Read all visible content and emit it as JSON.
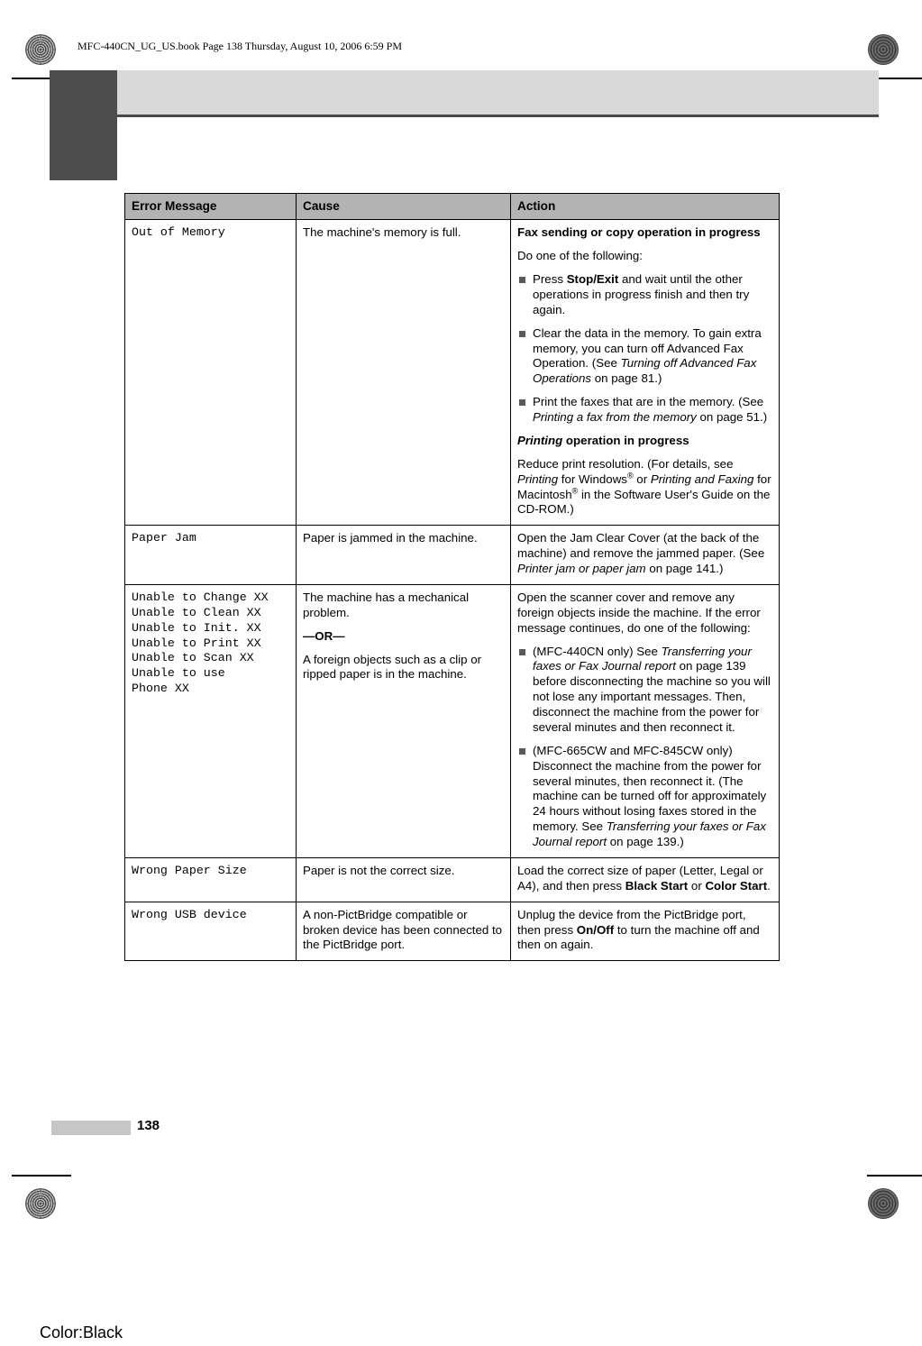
{
  "page": {
    "header_line": "MFC-440CN_UG_US.book  Page 138  Thursday, August 10, 2006  6:59 PM",
    "page_number": "138",
    "color_note": "Color:Black"
  },
  "table": {
    "headers": [
      "Error Message",
      "Cause",
      "Action"
    ],
    "rows": [
      {
        "error_message": "Out of Memory",
        "cause": "The machine's memory is full.",
        "action_blocks": [
          {
            "kind": "heading",
            "text": "Fax sending or copy operation in progress"
          },
          {
            "kind": "para",
            "text": "Do one of the following:"
          },
          {
            "kind": "bullets",
            "items": [
              "Press Stop/Exit and wait until the other operations in progress finish and then try again.",
              "Clear the data in the memory. To gain extra memory, you can turn off Advanced Fax Operation. (See Turning off Advanced Fax Operations on page 81.)",
              "Print the faxes that are in the memory. (See Printing a fax from the memory on page 51.)"
            ]
          },
          {
            "kind": "heading",
            "text": "Printing operation in progress"
          },
          {
            "kind": "para",
            "text": "Reduce print resolution. (For details, see Printing for Windows® or Printing and Faxing for Macintosh® in the Software User's Guide on the CD-ROM.)"
          }
        ]
      },
      {
        "error_message": "Paper Jam",
        "cause": "Paper is jammed in the machine.",
        "action_blocks": [
          {
            "kind": "para",
            "text": "Open the Jam Clear Cover (at the back of the machine) and remove the jammed paper. (See Printer jam or paper jam on page 141.)"
          }
        ]
      },
      {
        "error_message": "Unable to Change XX\nUnable to Clean XX\nUnable to Init. XX\nUnable to Print XX\nUnable to Scan XX\nUnable to use\nPhone XX",
        "cause_blocks": [
          {
            "kind": "para",
            "text": "The machine has a mechanical problem."
          },
          {
            "kind": "or",
            "text": "—OR—"
          },
          {
            "kind": "para",
            "text": "A foreign objects such as a clip or ripped paper is in the machine."
          }
        ],
        "action_blocks": [
          {
            "kind": "para",
            "text": "Open the scanner cover and remove any foreign objects inside the machine. If the error message continues, do one of the following:"
          },
          {
            "kind": "bullets",
            "items": [
              "(MFC-440CN only) See Transferring your faxes or Fax Journal report on page 139 before disconnecting the machine so you will not lose any important messages. Then, disconnect the machine from the power for several minutes and then reconnect it.",
              "(MFC-665CW and MFC-845CW only) Disconnect the machine from the power for several minutes, then reconnect it. (The machine can be turned off for approximately 24 hours without losing faxes stored in the memory. See Transferring your faxes or Fax Journal report on page 139.)"
            ]
          }
        ]
      },
      {
        "error_message": "Wrong Paper Size",
        "cause": "Paper is not the correct size.",
        "action_blocks": [
          {
            "kind": "para",
            "text": "Load the correct size of paper (Letter, Legal or A4), and then press Black Start or Color Start."
          }
        ]
      },
      {
        "error_message": "Wrong USB device",
        "cause": "A non-PictBridge compatible or broken device has been connected to the PictBridge port.",
        "action_blocks": [
          {
            "kind": "para",
            "text": "Unplug the device from the PictBridge port, then press On/Off to turn the machine off and then on again."
          }
        ]
      }
    ]
  }
}
